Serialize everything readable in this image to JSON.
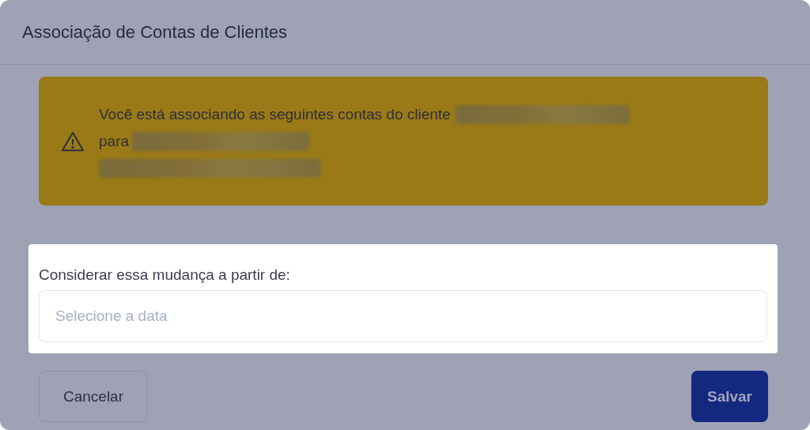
{
  "dialog": {
    "title": "Associação de Contas de Clientes"
  },
  "alert": {
    "lines": [
      {
        "text": "Você está associando as seguintes contas do cliente",
        "redacted": true
      },
      {
        "text": "para",
        "redacted": true
      },
      {
        "redacted": true
      }
    ]
  },
  "date_field": {
    "label": "Considerar essa mudança a partir de:",
    "placeholder": "Selecione a data"
  },
  "buttons": [
    {
      "label": "Cancelar",
      "kind": "secondary"
    },
    {
      "label": "Salvar",
      "kind": "primary"
    }
  ]
}
